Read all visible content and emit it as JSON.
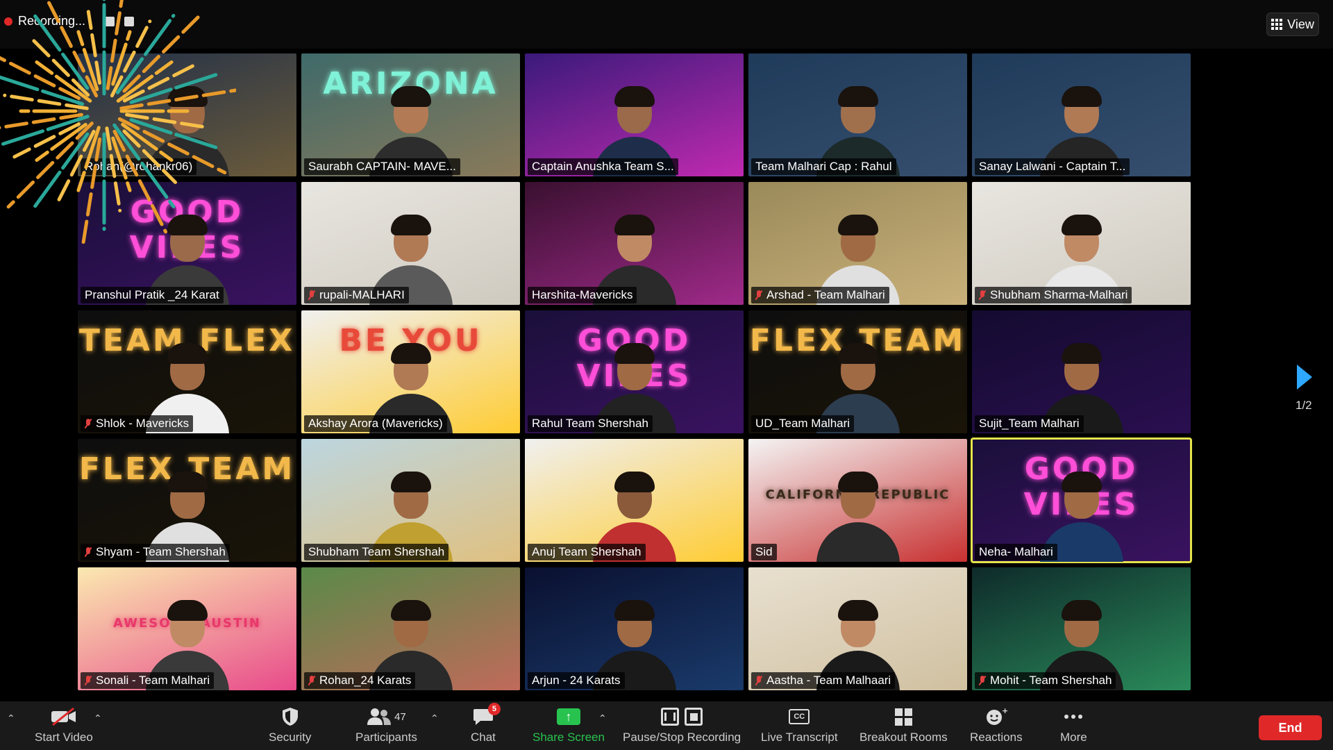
{
  "topbar": {
    "recording_label": "Recording...",
    "view_label": "View"
  },
  "tiles": [
    {
      "name": "Rohan(@rohankr06)",
      "muted": false,
      "bg": "#233148",
      "bg2": "#6a5a3a",
      "deco": "",
      "deco_color": "#ffd36b",
      "shirt": "#2a2a2a",
      "skin": "#a06a45"
    },
    {
      "name": "Saurabh CAPTAIN- MAVE...",
      "muted": false,
      "bg": "#3f6a6a",
      "bg2": "#8a7a5a",
      "deco": "ARIZONA",
      "deco_color": "#7ff1d6",
      "shirt": "#2d2d2d",
      "skin": "#b27a55"
    },
    {
      "name": "Captain Anushka Team S...",
      "muted": false,
      "bg": "#3a1a7a",
      "bg2": "#c02ab0",
      "deco": "",
      "deco_color": "#3ad0ff",
      "shirt": "#1e2e4a",
      "skin": "#9a6a4a"
    },
    {
      "name": "Team Malhari Cap : Rahul",
      "muted": false,
      "bg": "#1f3b5a",
      "bg2": "#364e6e",
      "deco": "",
      "deco_color": "#e23b2b",
      "shirt": "#1c2a2a",
      "skin": "#a0704d"
    },
    {
      "name": "Sanay Lalwani - Captain T...",
      "muted": false,
      "bg": "#1f3b5a",
      "bg2": "#364e6e",
      "deco": "",
      "deco_color": "#e23b2b",
      "shirt": "#252525",
      "skin": "#b07a55"
    },
    {
      "name": "Pranshul Pratik _24 Karat",
      "muted": false,
      "bg": "#1a0f3a",
      "bg2": "#3a1260",
      "deco": "GOOD VIBES",
      "deco_color": "#ff4fd8",
      "shirt": "#3a3a3a",
      "skin": "#9a6a4a"
    },
    {
      "name": "rupali-MALHARI",
      "muted": true,
      "bg": "#e8e6e0",
      "bg2": "#cfcac0",
      "deco": "",
      "deco_color": "#3a7a3a",
      "shirt": "#5a5a5a",
      "skin": "#b07a55"
    },
    {
      "name": "Harshita-Mavericks",
      "muted": false,
      "bg": "#3a1030",
      "bg2": "#a02a8a",
      "deco": "",
      "deco_color": "#d24ac0",
      "shirt": "#2a2a2a",
      "skin": "#c08a65"
    },
    {
      "name": "Arshad - Team Malhari",
      "muted": true,
      "bg": "#9a8a5a",
      "bg2": "#c9b07a",
      "deco": "",
      "deco_color": "#d9a03a",
      "shirt": "#e0e0e0",
      "skin": "#a06a45"
    },
    {
      "name": "Shubham Sharma-Malhari",
      "muted": true,
      "bg": "#e8e6e0",
      "bg2": "#cfcac0",
      "deco": "",
      "deco_color": "#3a7a3a",
      "shirt": "#e8e8e8",
      "skin": "#c08a65"
    },
    {
      "name": "Shlok - Mavericks",
      "muted": true,
      "bg": "#0e0e0e",
      "bg2": "#1a1408",
      "deco": "TEAM FLEX",
      "deco_color": "#f2b84a",
      "shirt": "#f0f0f0",
      "skin": "#a06a45"
    },
    {
      "name": "Akshay Arora (Mavericks)",
      "muted": false,
      "bg": "#f0f0f0",
      "bg2": "#ffcc33",
      "deco": "BE YOU",
      "deco_color": "#e84a3a",
      "shirt": "#2a2a2a",
      "skin": "#b07a55"
    },
    {
      "name": "Rahul Team Shershah",
      "muted": false,
      "bg": "#1a0f3a",
      "bg2": "#3a1260",
      "deco": "GOOD VIBES",
      "deco_color": "#ff4fd8",
      "shirt": "#222222",
      "skin": "#a06a45"
    },
    {
      "name": "UD_Team Malhari",
      "muted": false,
      "bg": "#0e0e0e",
      "bg2": "#1a1408",
      "deco": "FLEX TEAM",
      "deco_color": "#f2b84a",
      "shirt": "#2d3d50",
      "skin": "#a06a45"
    },
    {
      "name": "Sujit_Team Malhari",
      "muted": false,
      "bg": "#140b30",
      "bg2": "#2a0f50",
      "deco": "",
      "deco_color": "#ff3ab0",
      "shirt": "#1a1a1a",
      "skin": "#a06a45"
    },
    {
      "name": "Shyam - Team Shershah",
      "muted": true,
      "bg": "#0e0e0e",
      "bg2": "#1a1408",
      "deco": "FLEX TEAM",
      "deco_color": "#f2b84a",
      "shirt": "#e0e0e0",
      "skin": "#a06a45"
    },
    {
      "name": "Shubham Team Shershah",
      "muted": false,
      "bg": "#bcd6e0",
      "bg2": "#e0c080",
      "deco": "",
      "deco_color": "#2a6a3a",
      "shirt": "#c0a030",
      "skin": "#a06a45"
    },
    {
      "name": "Anuj Team Shershah",
      "muted": false,
      "bg": "#f0f0f0",
      "bg2": "#ffcc33",
      "deco": "",
      "deco_color": "#e84a3a",
      "shirt": "#c03030",
      "skin": "#8a5a3a"
    },
    {
      "name": "Sid",
      "muted": false,
      "bg": "#f4f4f4",
      "bg2": "#c83030",
      "deco": "CALIFORNIA REPUBLIC",
      "deco_color": "#3a2a1a",
      "shirt": "#2a2a2a",
      "skin": "#a06a45"
    },
    {
      "name": "Neha- Malhari",
      "muted": false,
      "bg": "#1a0f3a",
      "bg2": "#3a1260",
      "deco": "GOOD VIBES",
      "deco_color": "#ff4fd8",
      "shirt": "#1a3a6a",
      "skin": "#a06a45"
    },
    {
      "name": "Sonali - Team Malhari",
      "muted": true,
      "bg": "#fbe9b0",
      "bg2": "#e84a8a",
      "deco": "AWESOME AUSTIN",
      "deco_color": "#e8386a",
      "shirt": "#3a3a3a",
      "skin": "#c08a65"
    },
    {
      "name": "Rohan_24 Karats",
      "muted": true,
      "bg": "#5a8a4a",
      "bg2": "#c06a5a",
      "deco": "",
      "deco_color": "#f2d030",
      "shirt": "#2a2a2a",
      "skin": "#a06a45"
    },
    {
      "name": "Arjun - 24 Karats",
      "muted": false,
      "bg": "#0a1030",
      "bg2": "#1a3a6a",
      "deco": "",
      "deco_color": "#2a9a3a",
      "shirt": "#1a1a1a",
      "skin": "#a06a45"
    },
    {
      "name": "Aastha - Team Malhaari",
      "muted": true,
      "bg": "#e8e0d0",
      "bg2": "#d0c0a0",
      "deco": "",
      "deco_color": "#6a5a4a",
      "shirt": "#1a1a1a",
      "skin": "#c08a65"
    },
    {
      "name": "Mohit - Team Shershah",
      "muted": true,
      "bg": "#0e2a2a",
      "bg2": "#2a8a5a",
      "deco": "",
      "deco_color": "#3ad08a",
      "shirt": "#1a1a1a",
      "skin": "#a06a45"
    }
  ],
  "active_tile_index": 19,
  "pagination": {
    "label": "1/2"
  },
  "toolbar": {
    "start_video": "Start Video",
    "security": "Security",
    "participants": "Participants",
    "participants_count": "47",
    "chat": "Chat",
    "chat_badge": "5",
    "share_screen": "Share Screen",
    "pause_stop": "Pause/Stop Recording",
    "live_transcript": "Live Transcript",
    "cc_label": "CC",
    "breakout_rooms": "Breakout Rooms",
    "reactions": "Reactions",
    "more": "More",
    "end": "End"
  },
  "colors": {
    "active_border": "#e4e34a",
    "share_green": "#28c34f",
    "end_red": "#e02828",
    "arrow_blue": "#2fa8ff"
  }
}
